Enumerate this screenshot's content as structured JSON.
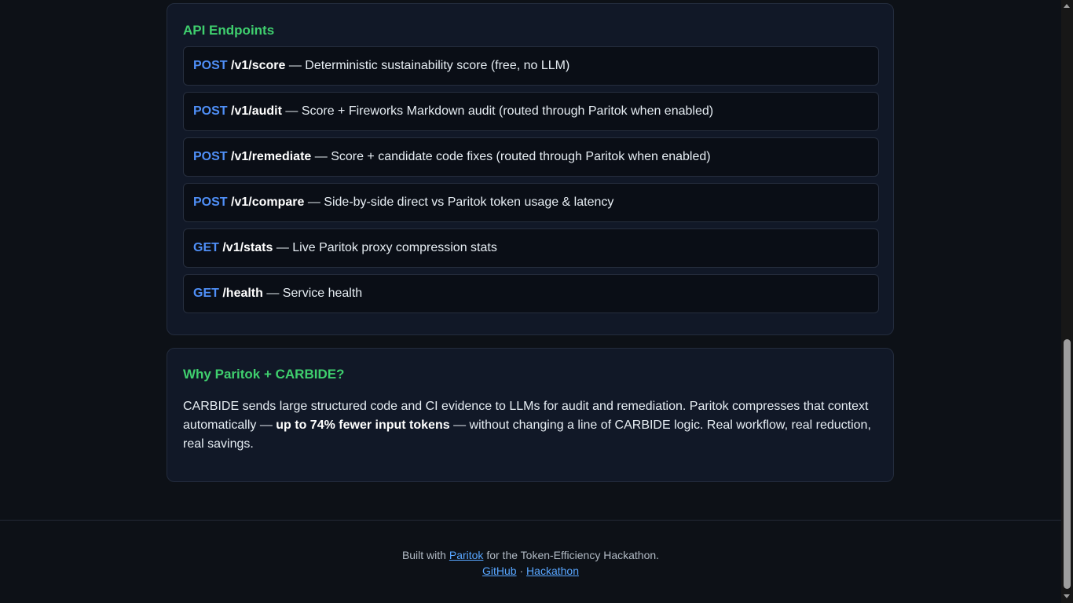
{
  "api": {
    "title": "API Endpoints",
    "endpoints": [
      {
        "method": "POST",
        "path": "/v1/score",
        "desc": " — Deterministic sustainability score (free, no LLM)"
      },
      {
        "method": "POST",
        "path": "/v1/audit",
        "desc": " — Score + Fireworks Markdown audit (routed through Paritok when enabled)"
      },
      {
        "method": "POST",
        "path": "/v1/remediate",
        "desc": " — Score + candidate code fixes (routed through Paritok when enabled)"
      },
      {
        "method": "POST",
        "path": "/v1/compare",
        "desc": " — Side-by-side direct vs Paritok token usage & latency"
      },
      {
        "method": "GET",
        "path": "/v1/stats",
        "desc": " — Live Paritok proxy compression stats"
      },
      {
        "method": "GET",
        "path": "/health",
        "desc": " — Service health"
      }
    ]
  },
  "why": {
    "title": "Why Paritok + CARBIDE?",
    "text_before": "CARBIDE sends large structured code and CI evidence to LLMs for audit and remediation. Paritok compresses that context automatically — ",
    "text_bold": "up to 74% fewer input tokens",
    "text_after": " — without changing a line of CARBIDE logic. Real workflow, real reduction, real savings."
  },
  "footer": {
    "built_prefix": "Built with ",
    "paritok_link": "Paritok",
    "built_suffix": " for the Token-Efficiency Hackathon.",
    "github_link": "GitHub",
    "separator": " · ",
    "hackathon_link": "Hackathon"
  }
}
